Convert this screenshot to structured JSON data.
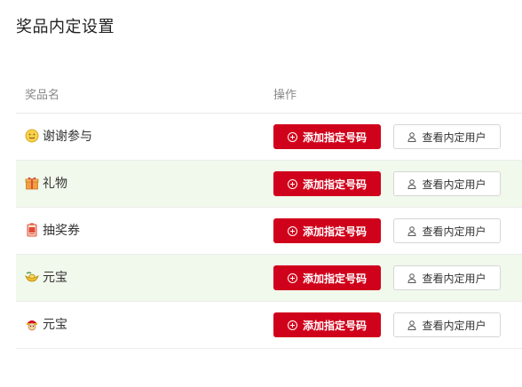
{
  "page": {
    "title": "奖品内定设置"
  },
  "table": {
    "columns": {
      "name": "奖品名",
      "ops": "操作"
    },
    "rows": [
      {
        "name": "谢谢参与",
        "icon": "smiley-face-icon",
        "add_label": "添加指定号码",
        "view_label": "查看内定用户"
      },
      {
        "name": "礼物",
        "icon": "gift-box-icon",
        "add_label": "添加指定号码",
        "view_label": "查看内定用户"
      },
      {
        "name": "抽奖券",
        "icon": "lottery-ticket-icon",
        "add_label": "添加指定号码",
        "view_label": "查看内定用户"
      },
      {
        "name": "元宝",
        "icon": "gold-ingot-icon",
        "add_label": "添加指定号码",
        "view_label": "查看内定用户"
      },
      {
        "name": "元宝",
        "icon": "lucky-god-icon",
        "add_label": "添加指定号码",
        "view_label": "查看内定用户"
      }
    ]
  },
  "colors": {
    "primary": "#d0021b",
    "alt_row": "#f1f8ec"
  }
}
